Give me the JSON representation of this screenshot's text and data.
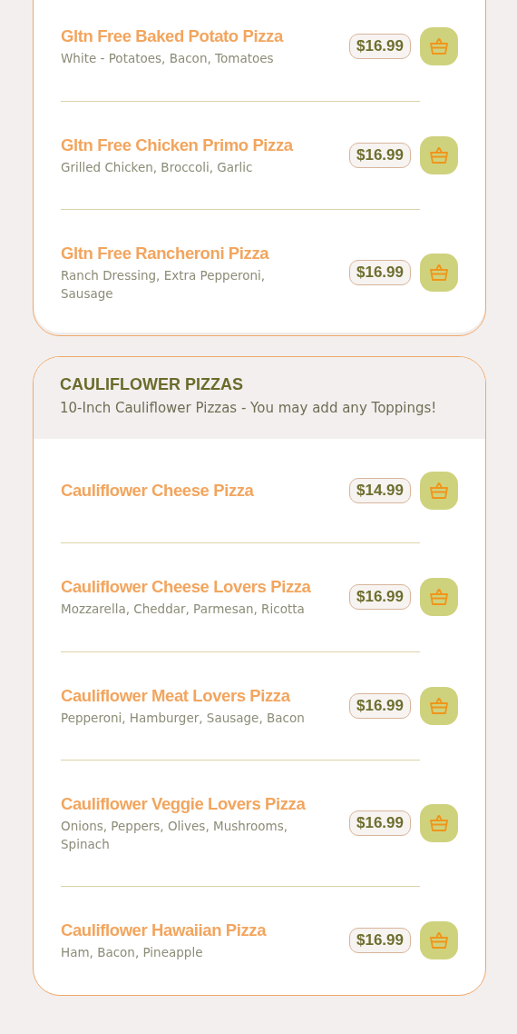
{
  "sections": [
    {
      "items": [
        {
          "name": "Gltn Free Baked Potato Pizza",
          "description": "White - Potatoes, Bacon, Tomatoes",
          "price": "$16.99"
        },
        {
          "name": "Gltn Free Chicken Primo Pizza",
          "description": "Grilled Chicken, Broccoli, Garlic",
          "price": "$16.99"
        },
        {
          "name": "Gltn Free Rancheroni Pizza",
          "description": "Ranch Dressing, Extra Pepperoni, Sausage",
          "price": "$16.99"
        }
      ]
    },
    {
      "title": "CAULIFLOWER PIZZAS",
      "subtitle": "10-Inch Cauliflower Pizzas - You may add any Toppings!",
      "items": [
        {
          "name": "Cauliflower Cheese Pizza",
          "price": "$14.99"
        },
        {
          "name": "Cauliflower Cheese Lovers Pizza",
          "description": "Mozzarella, Cheddar, Parmesan, Ricotta",
          "price": "$16.99"
        },
        {
          "name": "Cauliflower Meat Lovers Pizza",
          "description": "Pepperoni, Hamburger, Sausage, Bacon",
          "price": "$16.99"
        },
        {
          "name": "Cauliflower Veggie Lovers Pizza",
          "description": "Onions, Peppers, Olives, Mushrooms, Spinach",
          "price": "$16.99"
        },
        {
          "name": "Cauliflower Hawaiian Pizza",
          "description": "Ham, Bacon, Pineapple",
          "price": "$16.99"
        }
      ]
    }
  ]
}
